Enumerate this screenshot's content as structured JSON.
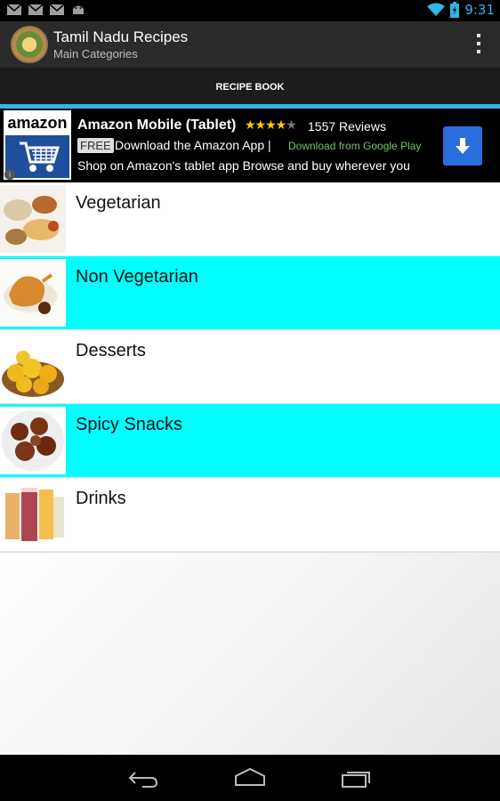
{
  "status_bar": {
    "time": "9:31",
    "icons": [
      "gmail-icon",
      "gmail-icon",
      "gmail-icon",
      "android-icon",
      "wifi-icon",
      "battery-icon"
    ]
  },
  "action_bar": {
    "title": "Tamil Nadu Recipes",
    "subtitle": "Main Categories",
    "menu_icon": "overflow-menu-icon"
  },
  "tabs": [
    {
      "label": "RECIPE BOOK",
      "selected": true
    }
  ],
  "ad": {
    "logo_text": "amazon",
    "title": "Amazon Mobile (Tablet)",
    "rating": 4,
    "rating_max": 5,
    "reviews": "1557 Reviews",
    "free_badge": "FREE",
    "description": "Download the Amazon App |",
    "store": "Download from Google Play",
    "line2": "Shop on Amazon's tablet app Browse and buy wherever you",
    "info": "i"
  },
  "categories": [
    {
      "label": "Vegetarian",
      "icon": "vegetarian-thumbnail-icon",
      "highlight": false
    },
    {
      "label": "Non Vegetarian",
      "icon": "non-vegetarian-thumbnail-icon",
      "highlight": true
    },
    {
      "label": "Desserts",
      "icon": "desserts-thumbnail-icon",
      "highlight": false
    },
    {
      "label": "Spicy Snacks",
      "icon": "spicy-snacks-thumbnail-icon",
      "highlight": true
    },
    {
      "label": "Drinks",
      "icon": "drinks-thumbnail-icon",
      "highlight": false
    }
  ],
  "nav_bar": {
    "buttons": [
      "back-icon",
      "home-icon",
      "recent-apps-icon"
    ]
  },
  "colors": {
    "accent": "#33b5e5",
    "highlight_row": "#00ffff",
    "action_bar": "#2b2b2b"
  }
}
